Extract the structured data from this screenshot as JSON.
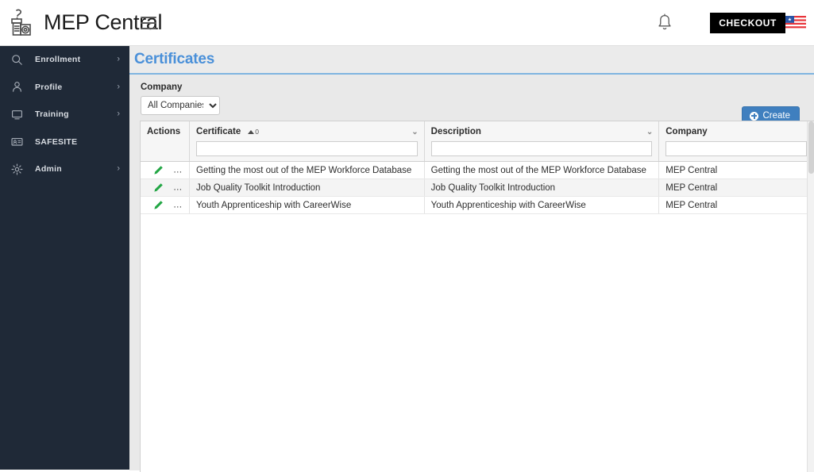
{
  "header": {
    "brand_name": "MEP Central",
    "logo_icon": "coffee-grinder-logo-icon",
    "menu_icon": "hamburger-menu-icon",
    "bell_icon": "notification-bell-icon",
    "checkout_label": "CHECKOUT",
    "flag_icon": "us-flag-icon"
  },
  "sidebar": {
    "items": [
      {
        "label": "Enrollment",
        "icon": "search-icon",
        "has_chevron": true
      },
      {
        "label": "Profile",
        "icon": "user-icon",
        "has_chevron": true
      },
      {
        "label": "Training",
        "icon": "monitor-icon",
        "has_chevron": true
      },
      {
        "label": "SAFESITE",
        "icon": "id-card-icon",
        "has_chevron": false
      },
      {
        "label": "Admin",
        "icon": "gear-icon",
        "has_chevron": true
      }
    ],
    "chevron_glyph": "›"
  },
  "page": {
    "title": "Certificates",
    "filter_label": "Company",
    "company_selected": "All Companies",
    "company_options": [
      "All Companies"
    ],
    "create_label": "Create"
  },
  "table": {
    "columns": [
      {
        "label": "Actions",
        "sortable": false,
        "has_chevron": false,
        "has_filter": false,
        "sort": null
      },
      {
        "label": "Certificate",
        "sortable": true,
        "has_chevron": true,
        "has_filter": true,
        "sort": "asc",
        "sort_index": "0",
        "filter_value": ""
      },
      {
        "label": "Description",
        "sortable": false,
        "has_chevron": true,
        "has_filter": true,
        "sort": null,
        "filter_value": ""
      },
      {
        "label": "Company",
        "sortable": false,
        "has_chevron": false,
        "has_filter": true,
        "sort": null,
        "filter_value": ""
      }
    ],
    "edit_icon": "edit-pencil-icon",
    "delete_icon": "delete-trash-icon",
    "rows": [
      {
        "certificate": "Getting the most out of the MEP Workforce Database",
        "description": "Getting the most out of the MEP Workforce Database",
        "company": "MEP Central"
      },
      {
        "certificate": "Job Quality Toolkit Introduction",
        "description": "Job Quality Toolkit Introduction",
        "company": "MEP Central"
      },
      {
        "certificate": "Youth Apprenticeship with CareerWise",
        "description": "Youth Apprenticeship with CareerWise",
        "company": "MEP Central"
      }
    ]
  },
  "colors": {
    "sidebar_bg": "#1f2937",
    "title_blue": "#4a90d9",
    "create_blue": "#3f7fbf",
    "checkout_bg": "#000000",
    "edit_green": "#22a644",
    "delete_red": "#e8423a",
    "content_bg": "#e9e9e9"
  }
}
